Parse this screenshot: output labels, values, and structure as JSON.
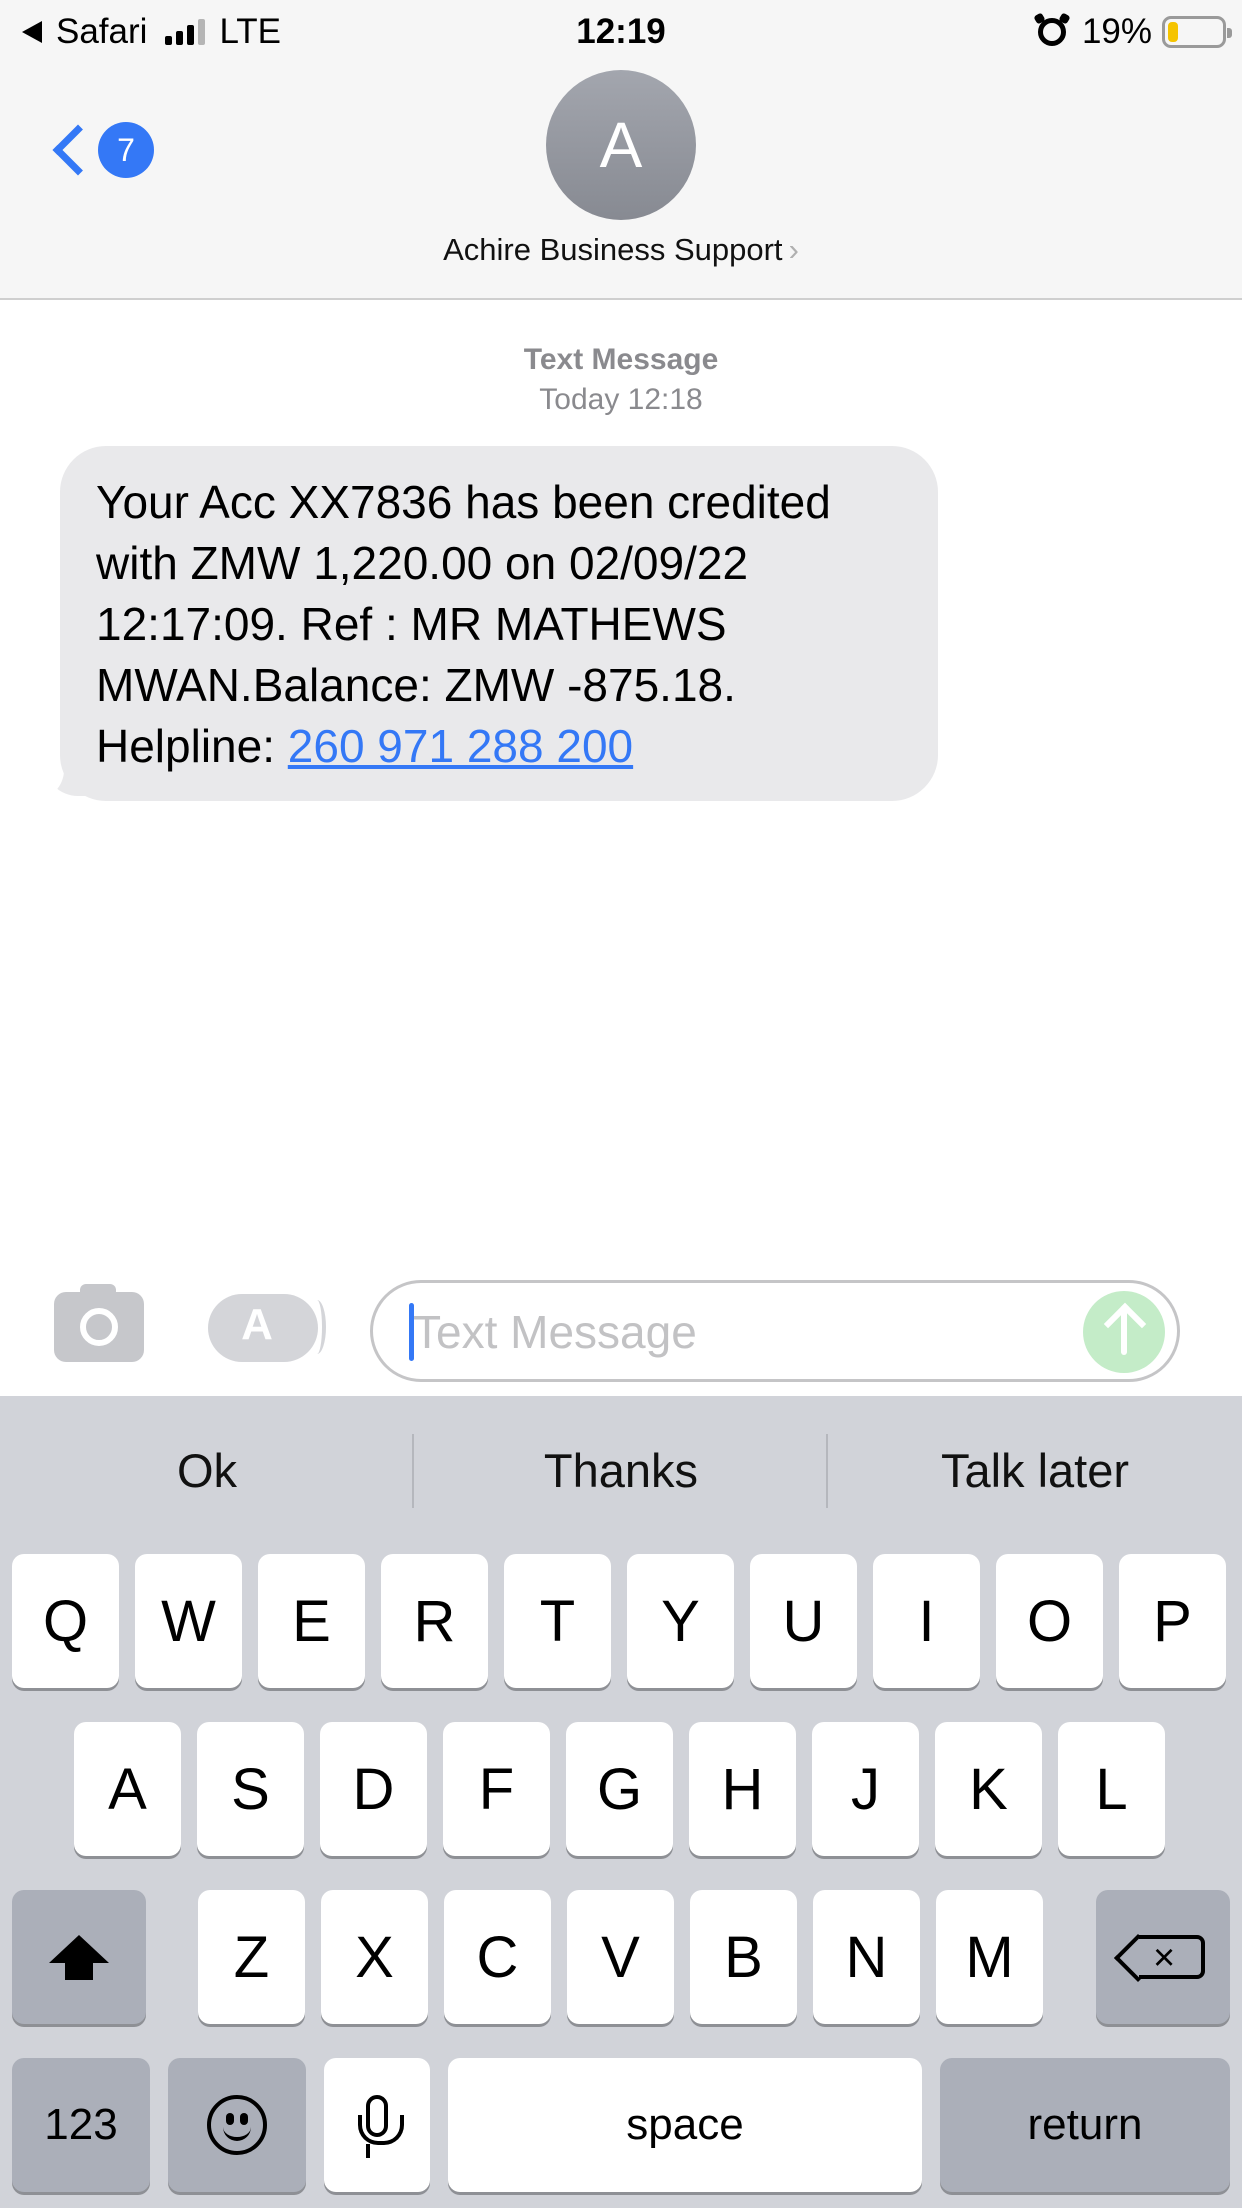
{
  "status_bar": {
    "back_app": "Safari",
    "network": "LTE",
    "time": "12:19",
    "battery_text": "19%",
    "battery_level": 0.19,
    "battery_color": "#f5c400",
    "signal_bars_active": 3
  },
  "header": {
    "back_badge_count": "7",
    "avatar_letter": "A",
    "contact_name": "Achire Business Support",
    "chevron": "›"
  },
  "conversation": {
    "message_kind": "Text Message",
    "timestamp": "Today 12:18",
    "message_text": "Your Acc XX7836 has been credited with ZMW 1,220.00 on 02/09/22 12:17:09. Ref : MR MATHEWS MWAN.Balance: ZMW -875.18. Helpline: ",
    "helpline_link": "260 971 288 200"
  },
  "input_bar": {
    "placeholder": "Text Message",
    "appstore_glyph": "A"
  },
  "keyboard": {
    "suggestions": [
      "Ok",
      "Thanks",
      "Talk later"
    ],
    "row1": [
      "Q",
      "W",
      "E",
      "R",
      "T",
      "Y",
      "U",
      "I",
      "O",
      "P"
    ],
    "row2": [
      "A",
      "S",
      "D",
      "F",
      "G",
      "H",
      "J",
      "K",
      "L"
    ],
    "row3": [
      "Z",
      "X",
      "C",
      "V",
      "B",
      "N",
      "M"
    ],
    "numbers_label": "123",
    "space_label": "space",
    "return_label": "return",
    "delete_glyph": "×"
  },
  "colors": {
    "accent": "#3478f6",
    "bubble": "#e9e9eb",
    "keyboard_bg": "#d1d3d9",
    "send_disabled": "#c4ecc8"
  },
  "icons": [
    "back-chevron-icon",
    "signal-icon",
    "alarm-icon",
    "battery-icon",
    "camera-icon",
    "app-store-icon",
    "send-arrow-icon",
    "shift-icon",
    "delete-icon",
    "emoji-icon",
    "microphone-icon"
  ]
}
